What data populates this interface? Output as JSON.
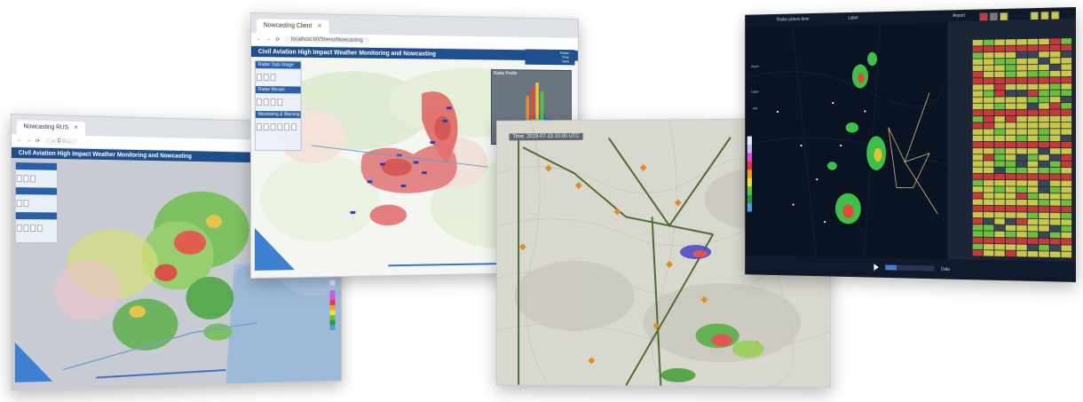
{
  "shot1": {
    "tab_title": "Nowcasting RUS",
    "url": "→ C  ⌂  ...",
    "app_title": "Civil Aviation High Impact Weather Monitoring and Nowcasting"
  },
  "shot2": {
    "tab_title": "Nowcasting Client",
    "url": "localhost:80/Sheno/Nowcasting",
    "app_title": "Civil Aviation High Impact Weather Monitoring and Nowcasting",
    "info_lines": [
      "Radar: ...",
      "Time: ...",
      "Valid: ..."
    ],
    "inset_title": "Radar Profile",
    "panel_sections": [
      "Radar Data Image",
      "Radar Mosaic",
      "Monitoring & Warning"
    ]
  },
  "shot3": {
    "time_label": "Time: 2019-07-13 10:00 UTC"
  },
  "shot4": {
    "top_label_left": "Radar picture time",
    "top_label_mid": "Label",
    "tab_label": "Airport",
    "tools": [
      "Zoom",
      "Layer",
      "Info"
    ],
    "bottom_label": "Data",
    "colors": {
      "yellow": "#c8c84c",
      "green": "#6fbf3f",
      "red": "#c63a3a",
      "gray": "#3a4558"
    }
  }
}
